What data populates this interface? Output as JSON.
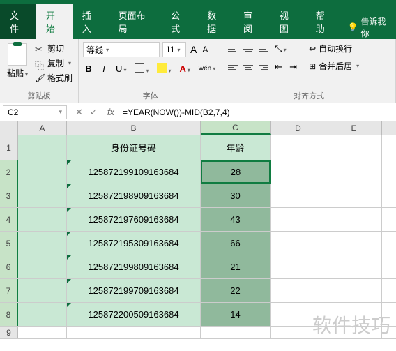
{
  "qat": {
    "save": "💾",
    "undo": "↶",
    "redo": "↷"
  },
  "tabs": {
    "file": "文件",
    "home": "开始",
    "insert": "插入",
    "layout": "页面布局",
    "formulas": "公式",
    "data": "数据",
    "review": "审阅",
    "view": "视图",
    "help": "帮助",
    "tellme": "告诉我你"
  },
  "ribbon": {
    "clipboard": {
      "label": "剪贴板",
      "paste": "粘贴",
      "cut": "剪切",
      "copy": "复制",
      "format": "格式刷"
    },
    "font": {
      "label": "字体",
      "name": "等线",
      "size": "11"
    },
    "align": {
      "label": "对齐方式",
      "wrap": "自动换行",
      "merge": "合并后居"
    }
  },
  "namebox": "C2",
  "formula": "=YEAR(NOW())-MID(B2,7,4)",
  "headers": {
    "A": "A",
    "B": "B",
    "C": "C",
    "D": "D",
    "E": "E"
  },
  "rowData": {
    "header": {
      "B": "身份证号码",
      "C": "年龄"
    },
    "rows": [
      {
        "n": "1"
      },
      {
        "n": "2",
        "B": "125872199109163684",
        "C": "28"
      },
      {
        "n": "3",
        "B": "125872198909163684",
        "C": "30"
      },
      {
        "n": "4",
        "B": "125872197609163684",
        "C": "43"
      },
      {
        "n": "5",
        "B": "125872195309163684",
        "C": "66"
      },
      {
        "n": "6",
        "B": "125872199809163684",
        "C": "21"
      },
      {
        "n": "7",
        "B": "125872199709163684",
        "C": "22"
      },
      {
        "n": "8",
        "B": "125872200509163684",
        "C": "14"
      },
      {
        "n": "9"
      }
    ]
  },
  "watermark": "软件技巧"
}
